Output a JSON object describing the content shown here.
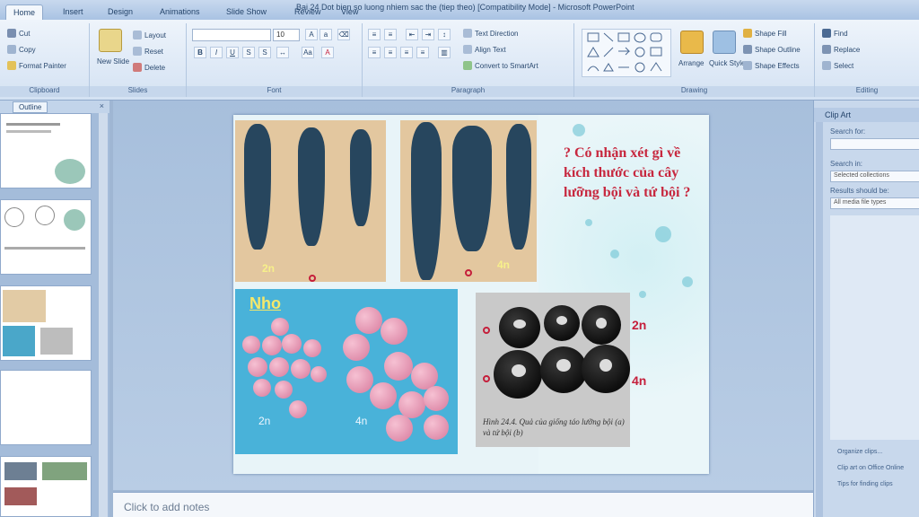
{
  "window": {
    "title": "Bai 24 Dot bien so luong nhiem sac the (tiep theo) [Compatibility Mode] - Microsoft PowerPoint"
  },
  "tabs": [
    "Home",
    "Insert",
    "Design",
    "Animations",
    "Slide Show",
    "Review",
    "View"
  ],
  "ribbon": {
    "clipboard": {
      "cut": "Cut",
      "copy": "Copy",
      "format_painter": "Format Painter",
      "label": "Clipboard"
    },
    "slides": {
      "new_slide": "New Slide",
      "layout": "Layout",
      "reset": "Reset",
      "delete": "Delete",
      "label": "Slides"
    },
    "font": {
      "size": "10",
      "label": "Font"
    },
    "paragraph": {
      "text_direction": "Text Direction",
      "align_text": "Align Text",
      "convert": "Convert to SmartArt",
      "label": "Paragraph"
    },
    "drawing": {
      "arrange": "Arrange",
      "quick_styles": "Quick Styles",
      "shape_fill": "Shape Fill",
      "shape_outline": "Shape Outline",
      "shape_effects": "Shape Effects",
      "label": "Drawing"
    },
    "editing": {
      "find": "Find",
      "replace": "Replace",
      "select": "Select",
      "label": "Editing"
    }
  },
  "left_panel": {
    "tab_label": "Outline",
    "close": "×"
  },
  "slide": {
    "question": "? Có nhận xét gì về kích thước của cây lưỡng bội và tứ bội ?",
    "label_2n_left": "2n",
    "label_4n_top": "4n",
    "nho_title": "Nho",
    "grape_2n": "2n",
    "grape_4n": "4n",
    "fruit_2n": "2n",
    "fruit_4n": "4n",
    "caption": "Hình 24.4. Quả của giống táo lưỡng bội (a) và tứ bội (b)"
  },
  "notes": {
    "placeholder": "Click to add notes"
  },
  "task_pane": {
    "title": "Clip Art",
    "search_for": "Search for:",
    "search_in": "Search in:",
    "search_in_value": "Selected collections",
    "results": "Results should be:",
    "results_value": "All media file types",
    "links": [
      "Organize clips...",
      "Clip art on Office Online",
      "Tips for finding clips"
    ]
  }
}
